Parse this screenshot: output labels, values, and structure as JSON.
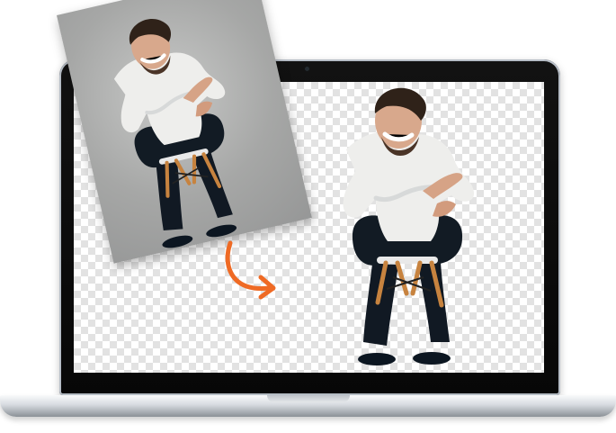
{
  "scene": {
    "background_color": "#ffffff",
    "laptop_color": "#0b0b0b",
    "screen_checker_light": "#ffffff",
    "screen_checker_dark": "#e2e2e2",
    "photo_background": "#a6a7a6",
    "arrow_color": "#ef6a24",
    "arrow_icon": "curved-arrow-icon",
    "subject": "person-seated-on-stool"
  }
}
